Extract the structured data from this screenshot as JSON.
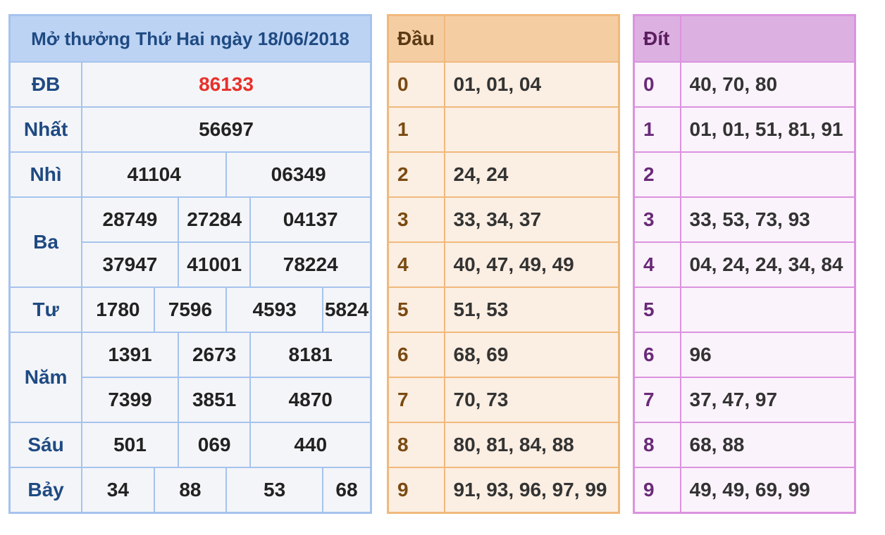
{
  "results": {
    "title": "Mở thưởng Thứ Hai ngày 18/06/2018",
    "db_label": "ĐB",
    "db": "86133",
    "nhat_label": "Nhất",
    "nhat": "56697",
    "nhi_label": "Nhì",
    "nhi": [
      "41104",
      "06349"
    ],
    "ba_label": "Ba",
    "ba": [
      "28749",
      "27284",
      "04137",
      "37947",
      "41001",
      "78224"
    ],
    "tu_label": "Tư",
    "tu": [
      "1780",
      "7596",
      "4593",
      "5824"
    ],
    "nam_label": "Năm",
    "nam": [
      "1391",
      "2673",
      "8181",
      "7399",
      "3851",
      "4870"
    ],
    "sau_label": "Sáu",
    "sau": [
      "501",
      "069",
      "440"
    ],
    "bay_label": "Bảy",
    "bay": [
      "34",
      "88",
      "53",
      "68"
    ]
  },
  "dau": {
    "header": "Đầu",
    "rows": [
      {
        "digit": "0",
        "values": "01, 01, 04"
      },
      {
        "digit": "1",
        "values": ""
      },
      {
        "digit": "2",
        "values": "24, 24"
      },
      {
        "digit": "3",
        "values": "33, 34, 37"
      },
      {
        "digit": "4",
        "values": "40, 47, 49, 49"
      },
      {
        "digit": "5",
        "values": "51, 53"
      },
      {
        "digit": "6",
        "values": "68, 69"
      },
      {
        "digit": "7",
        "values": "70, 73"
      },
      {
        "digit": "8",
        "values": "80, 81, 84, 88"
      },
      {
        "digit": "9",
        "values": "91, 93, 96, 97, 99"
      }
    ]
  },
  "dit": {
    "header": "Đít",
    "rows": [
      {
        "digit": "0",
        "values": "40, 70, 80"
      },
      {
        "digit": "1",
        "values": "01, 01, 51, 81, 91"
      },
      {
        "digit": "2",
        "values": ""
      },
      {
        "digit": "3",
        "values": "33, 53, 73, 93"
      },
      {
        "digit": "4",
        "values": "04, 24, 24, 34, 84"
      },
      {
        "digit": "5",
        "values": ""
      },
      {
        "digit": "6",
        "values": "96"
      },
      {
        "digit": "7",
        "values": "37, 47, 97"
      },
      {
        "digit": "8",
        "values": "68, 88"
      },
      {
        "digit": "9",
        "values": "49, 49, 69, 99"
      }
    ]
  },
  "colors": {
    "results_border": "#a6c3ee",
    "special_prize": "#e8302a",
    "dau_border": "#f0b97c",
    "dit_border": "#db93df"
  }
}
